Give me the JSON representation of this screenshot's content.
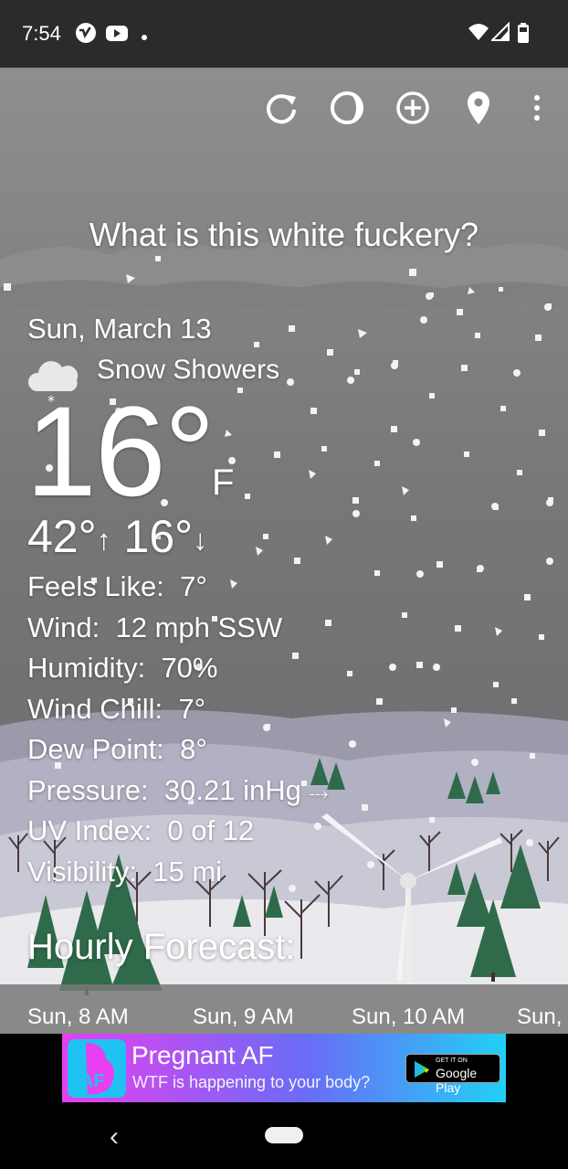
{
  "status_bar": {
    "time": "7:54",
    "icons": [
      "vimeo-icon",
      "youtube-icon",
      "dot-icon",
      "wifi-icon",
      "signal-icon",
      "battery-icon"
    ]
  },
  "toolbar": {
    "icons": [
      "refresh-icon",
      "theme-icon",
      "add-location-icon",
      "location-pin-icon",
      "more-vert-icon"
    ]
  },
  "headline": "What is this white fuckery?",
  "current": {
    "date": "Sun, March 13",
    "condition": "Snow Showers",
    "condition_icon": "snow-cloud-icon",
    "temperature": "16°",
    "unit": "F",
    "high": "42°",
    "low": "16°",
    "high_arrow": "↑",
    "low_arrow": "↓"
  },
  "details": [
    {
      "label": "Feels Like:",
      "value": "7°"
    },
    {
      "label": "Wind:",
      "value": "12 mph SSW"
    },
    {
      "label": "Humidity:",
      "value": "70%"
    },
    {
      "label": "Wind Chill:",
      "value": "7°"
    },
    {
      "label": "Dew Point:",
      "value": "8°"
    },
    {
      "label": "Pressure:",
      "value": "30.21 inHg",
      "suffix": "⤏"
    },
    {
      "label": "UV Index:",
      "value": "0 of 12"
    },
    {
      "label": "Visibility:",
      "value": "15 mi"
    }
  ],
  "hourly": {
    "title": "Hourly Forecast:",
    "hours": [
      "Sun, 8 AM",
      "Sun, 9 AM",
      "Sun, 10 AM",
      "Sun,"
    ]
  },
  "ad": {
    "logo_text": "AF",
    "title": "Pregnant AF",
    "subtitle": "WTF is happening to your body?",
    "store_small": "GET IT ON",
    "store_big": "Google Play"
  },
  "colors": {
    "sky": "#7a7a7a",
    "hills": "#b4b4c8",
    "trees": "#2f6b4a",
    "ad_gradient_start": "#e83ff0",
    "ad_gradient_end": "#21d0f5"
  }
}
